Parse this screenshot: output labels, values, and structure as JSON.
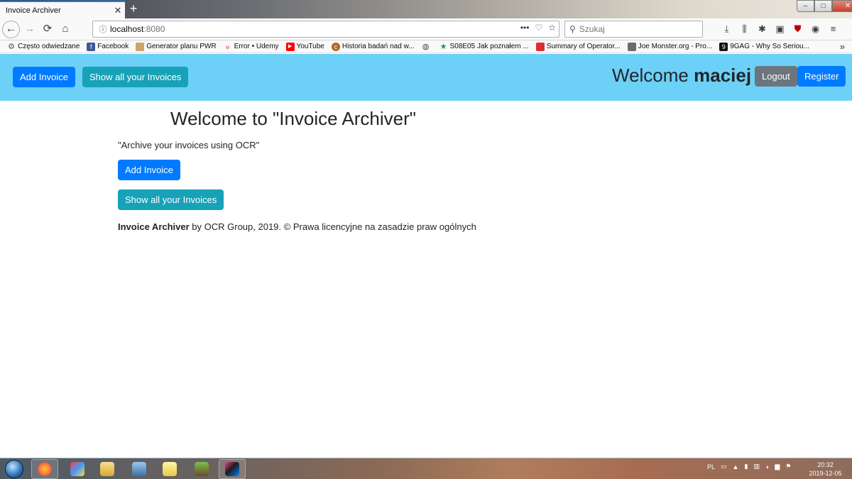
{
  "browser": {
    "tab_title": "Invoice Archiver",
    "tab_close": "✕",
    "new_tab": "+",
    "url_host": "localhost",
    "url_port": ":8080",
    "search_placeholder": "Szukaj",
    "bookmarks": [
      {
        "label": "Często odwiedzane",
        "icon": "gear-icon",
        "color": "#555555"
      },
      {
        "label": "Facebook",
        "icon": "facebook-icon",
        "color": "#3b5998"
      },
      {
        "label": "Generator planu PWR",
        "icon": "page-icon",
        "color": "#c9a66b"
      },
      {
        "label": "Error • Udemy",
        "icon": "udemy-icon",
        "color": "#ec5252"
      },
      {
        "label": "YouTube",
        "icon": "youtube-icon",
        "color": "#ff0000"
      },
      {
        "label": "Historia badań nad w...",
        "icon": "history-icon",
        "color": "#b5651d"
      },
      {
        "label": "",
        "icon": "globe-icon",
        "color": "#444444"
      },
      {
        "label": "S08E05 Jak poznałem ...",
        "icon": "star-icon",
        "color": "#2e8b57"
      },
      {
        "label": "Summary of Operator...",
        "icon": "docs-icon",
        "color": "#d9302c"
      },
      {
        "label": "Joe Monster.org - Pro...",
        "icon": "joemonster-icon",
        "color": "#6b6b6b"
      },
      {
        "label": "9GAG - Why So Seriou...",
        "icon": "9gag-icon",
        "color": "#111111"
      }
    ]
  },
  "header": {
    "add_invoice": "Add Invoice",
    "show_invoices": "Show all your Invoices",
    "welcome_prefix": "Welcome ",
    "username": "maciej",
    "logout": "Logout",
    "register": "Register",
    "bg_color": "#6dd0f7"
  },
  "main": {
    "title": "Welcome to \"Invoice Archiver\"",
    "tagline": "\"Archive your invoices using OCR\"",
    "add_invoice": "Add Invoice",
    "show_invoices": "Show all your Invoices"
  },
  "footer": {
    "app_name": "Invoice Archiver",
    "rest": " by OCR Group, 2019. © Prawa licencyjne na zasadzie praw ogólnych"
  },
  "taskbar": {
    "language": "PL",
    "time": "20:32",
    "date": "2019-12-05"
  },
  "colors": {
    "primary": "#007bff",
    "info": "#17a2b8",
    "secondary": "#6c757d"
  }
}
